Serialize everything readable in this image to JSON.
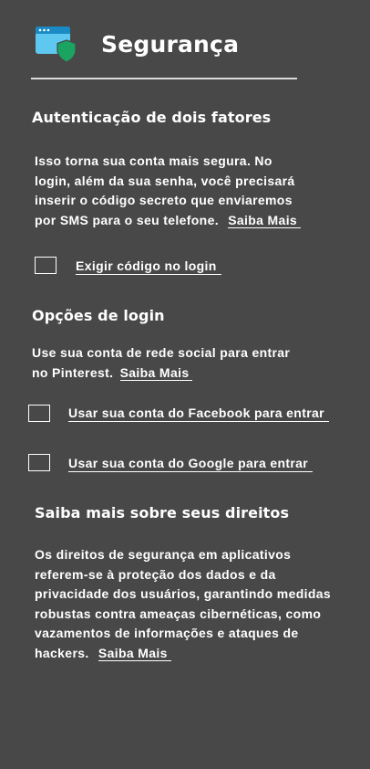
{
  "header": {
    "title": "Segurança",
    "icon": "browser-shield-icon",
    "icon_colors": {
      "window": "#5ec8f0",
      "bar": "#1a8ac4",
      "shield": "#1aa361"
    }
  },
  "two_factor": {
    "heading": "Autenticação de dois fatores",
    "description": [
      "Isso torna sua conta mais segura. No",
      "login, além da sua senha, você precisará",
      "inserir o código secreto que enviaremos",
      "por SMS para o seu telefone."
    ],
    "learn_more": "Saiba Mais",
    "require_code_label": "Exigir código no login",
    "require_code_checked": false
  },
  "login_options": {
    "heading": "Opções de login",
    "description": [
      "Use sua conta de rede social para entrar",
      "no Pinterest."
    ],
    "learn_more": "Saiba Mais",
    "facebook_label": "Usar sua conta do Facebook para entrar",
    "facebook_checked": false,
    "google_label": "Usar sua conta do Google para entrar",
    "google_checked": false
  },
  "rights": {
    "heading": "Saiba mais sobre seus direitos",
    "description": [
      "Os direitos de segurança em aplicativos",
      "referem-se à proteção dos dados e da",
      "privacidade dos usuários, garantindo medidas",
      "robustas contra ameaças cibernéticas, como",
      "vazamentos de informações e ataques de",
      "hackers."
    ],
    "learn_more": "Saiba Mais"
  },
  "colors": {
    "background": "#484848",
    "text": "#ffffff",
    "rule": "#d9d9d9"
  }
}
